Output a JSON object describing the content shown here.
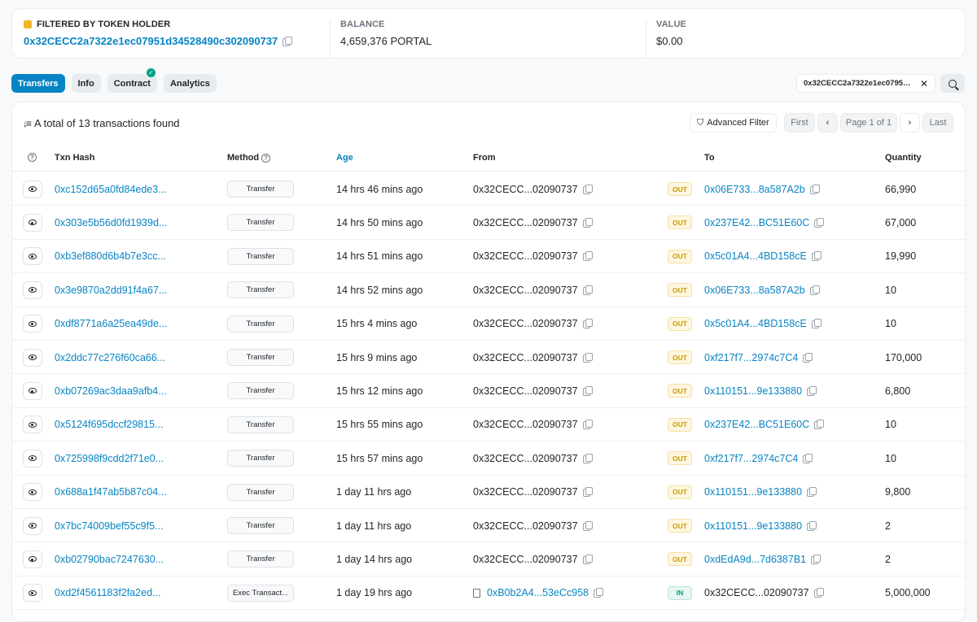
{
  "holder": {
    "label": "FILTERED BY TOKEN HOLDER",
    "address": "0x32CECC2a7322e1ec07951d34528490c302090737",
    "balance_label": "BALANCE",
    "balance_value": "4,659,376 PORTAL",
    "value_label": "VALUE",
    "value_value": "$0.00"
  },
  "tabs": [
    {
      "label": "Transfers",
      "active": true
    },
    {
      "label": "Info"
    },
    {
      "label": "Contract",
      "verified": true
    },
    {
      "label": "Analytics"
    }
  ],
  "filter_chip": {
    "text": "0x32CECC2a7322e1ec07951d..."
  },
  "summary": {
    "text": "A total of 13 transactions found"
  },
  "toolbar": {
    "advanced_filter": "Advanced Filter",
    "first": "First",
    "page": "Page 1 of 1",
    "last": "Last"
  },
  "columns": {
    "txn_hash": "Txn Hash",
    "method": "Method",
    "age": "Age",
    "from": "From",
    "to": "To",
    "quantity": "Quantity"
  },
  "rows": [
    {
      "hash": "0xc152d65a0fd84ede3...",
      "method": "Transfer",
      "age": "14 hrs 46 mins ago",
      "from": "0x32CECC...02090737",
      "dir": "OUT",
      "to": "0x06E733...8a587A2b",
      "qty": "66,990"
    },
    {
      "hash": "0x303e5b56d0fd1939d...",
      "method": "Transfer",
      "age": "14 hrs 50 mins ago",
      "from": "0x32CECC...02090737",
      "dir": "OUT",
      "to": "0x237E42...BC51E60C",
      "qty": "67,000"
    },
    {
      "hash": "0xb3ef880d6b4b7e3cc...",
      "method": "Transfer",
      "age": "14 hrs 51 mins ago",
      "from": "0x32CECC...02090737",
      "dir": "OUT",
      "to": "0x5c01A4...4BD158cE",
      "qty": "19,990"
    },
    {
      "hash": "0x3e9870a2dd91f4a67...",
      "method": "Transfer",
      "age": "14 hrs 52 mins ago",
      "from": "0x32CECC...02090737",
      "dir": "OUT",
      "to": "0x06E733...8a587A2b",
      "qty": "10"
    },
    {
      "hash": "0xdf8771a6a25ea49de...",
      "method": "Transfer",
      "age": "15 hrs 4 mins ago",
      "from": "0x32CECC...02090737",
      "dir": "OUT",
      "to": "0x5c01A4...4BD158cE",
      "qty": "10"
    },
    {
      "hash": "0x2ddc77c276f60ca66...",
      "method": "Transfer",
      "age": "15 hrs 9 mins ago",
      "from": "0x32CECC...02090737",
      "dir": "OUT",
      "to": "0xf217f7...2974c7C4",
      "qty": "170,000"
    },
    {
      "hash": "0xb07269ac3daa9afb4...",
      "method": "Transfer",
      "age": "15 hrs 12 mins ago",
      "from": "0x32CECC...02090737",
      "dir": "OUT",
      "to": "0x110151...9e133880",
      "qty": "6,800"
    },
    {
      "hash": "0x5124f695dccf29815...",
      "method": "Transfer",
      "age": "15 hrs 55 mins ago",
      "from": "0x32CECC...02090737",
      "dir": "OUT",
      "to": "0x237E42...BC51E60C",
      "qty": "10"
    },
    {
      "hash": "0x725998f9cdd2f71e0...",
      "method": "Transfer",
      "age": "15 hrs 57 mins ago",
      "from": "0x32CECC...02090737",
      "dir": "OUT",
      "to": "0xf217f7...2974c7C4",
      "qty": "10"
    },
    {
      "hash": "0x688a1f47ab5b87c04...",
      "method": "Transfer",
      "age": "1 day 11 hrs ago",
      "from": "0x32CECC...02090737",
      "dir": "OUT",
      "to": "0x110151...9e133880",
      "qty": "9,800"
    },
    {
      "hash": "0x7bc74009bef55c9f5...",
      "method": "Transfer",
      "age": "1 day 11 hrs ago",
      "from": "0x32CECC...02090737",
      "dir": "OUT",
      "to": "0x110151...9e133880",
      "qty": "2"
    },
    {
      "hash": "0xb02790bac7247630...",
      "method": "Transfer",
      "age": "1 day 14 hrs ago",
      "from": "0x32CECC...02090737",
      "dir": "OUT",
      "to": "0xdEdA9d...7d6387B1",
      "qty": "2"
    },
    {
      "hash": "0xd2f4561183f2fa2ed...",
      "method": "Exec Transact...",
      "age": "1 day 19 hrs ago",
      "from": "0xB0b2A4...53eCc958",
      "from_is_contract": true,
      "dir": "IN",
      "to": "0x32CECC...02090737",
      "to_is_self": true,
      "qty": "5,000,000"
    }
  ]
}
